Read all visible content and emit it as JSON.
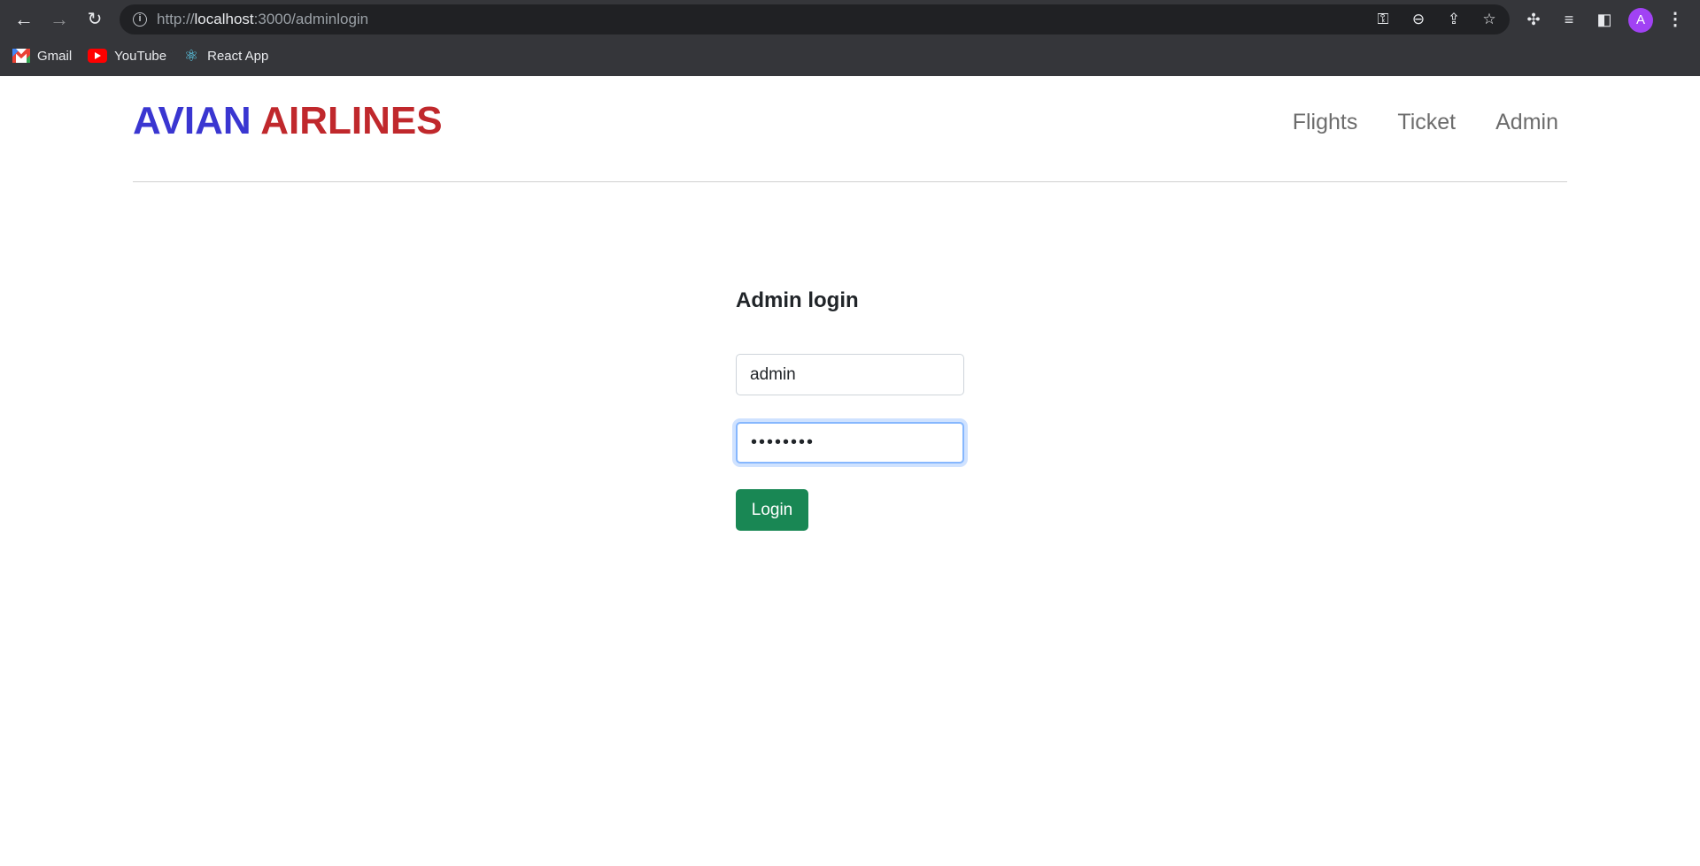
{
  "browser": {
    "url_prefix": "http://",
    "url_host": "localhost",
    "url_rest": ":3000/adminlogin",
    "avatar_letter": "A",
    "bookmarks": [
      {
        "label": "Gmail",
        "icon": "gmail-icon"
      },
      {
        "label": "YouTube",
        "icon": "youtube-icon"
      },
      {
        "label": "React App",
        "icon": "react-icon"
      }
    ]
  },
  "header": {
    "brand_part1": "AVIAN",
    "brand_part2": "AIRLINES",
    "nav": [
      "Flights",
      "Ticket",
      "Admin"
    ]
  },
  "login": {
    "title": "Admin login",
    "username_value": "admin",
    "password_value": "••••••••",
    "button_label": "Login"
  },
  "colors": {
    "brand_blue": "#3a36d1",
    "brand_red": "#c0282c",
    "button_green": "#198754",
    "focus_ring": "#86b7fe"
  }
}
